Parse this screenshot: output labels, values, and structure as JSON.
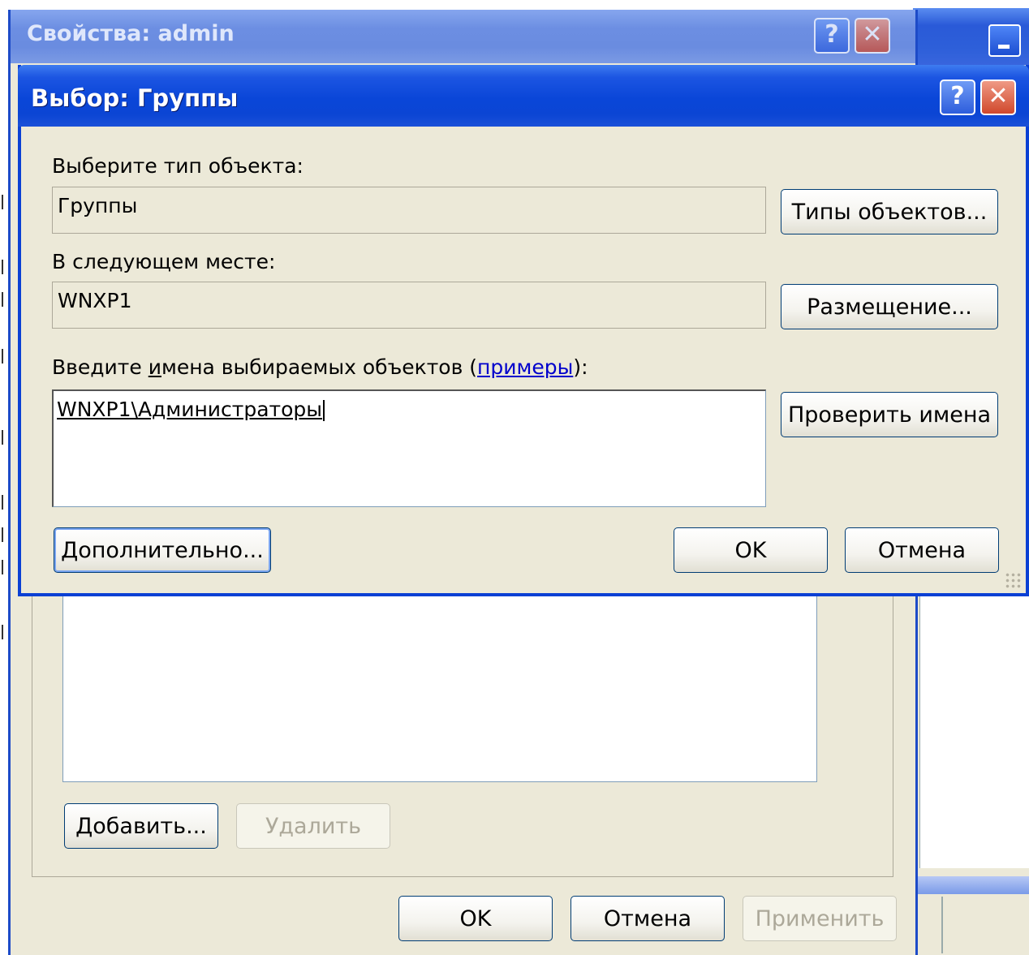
{
  "properties_window": {
    "title": "Свойства: admin",
    "help_glyph": "?",
    "close_glyph": "✕",
    "add_button": "Добавить...",
    "remove_button": "Удалить",
    "ok_button": "OK",
    "cancel_button": "Отмена",
    "apply_button": "Применить"
  },
  "select_groups_dialog": {
    "title": "Выбор: Группы",
    "help_glyph": "?",
    "close_glyph": "✕",
    "object_type_label": "Выберите тип объекта:",
    "object_type_value": "Группы",
    "object_types_button": "Типы объектов...",
    "location_label": "В следующем месте:",
    "location_value": "WNXP1",
    "locations_button": "Размещение...",
    "names_label_prefix": "Введите ",
    "names_label_accel": "и",
    "names_label_rest": "мена выбираемых объектов (",
    "names_label_link": "примеры",
    "names_label_suffix": "):",
    "names_value": "WNXP1\\Администраторы",
    "check_names_button": "Проверить имена",
    "advanced_button": "Дополнительно...",
    "ok_button": "OK",
    "cancel_button": "Отмена"
  },
  "colors": {
    "xp_blue_title": "#0a46d8",
    "dialog_face": "#ece9d8",
    "link": "#0000cc"
  }
}
